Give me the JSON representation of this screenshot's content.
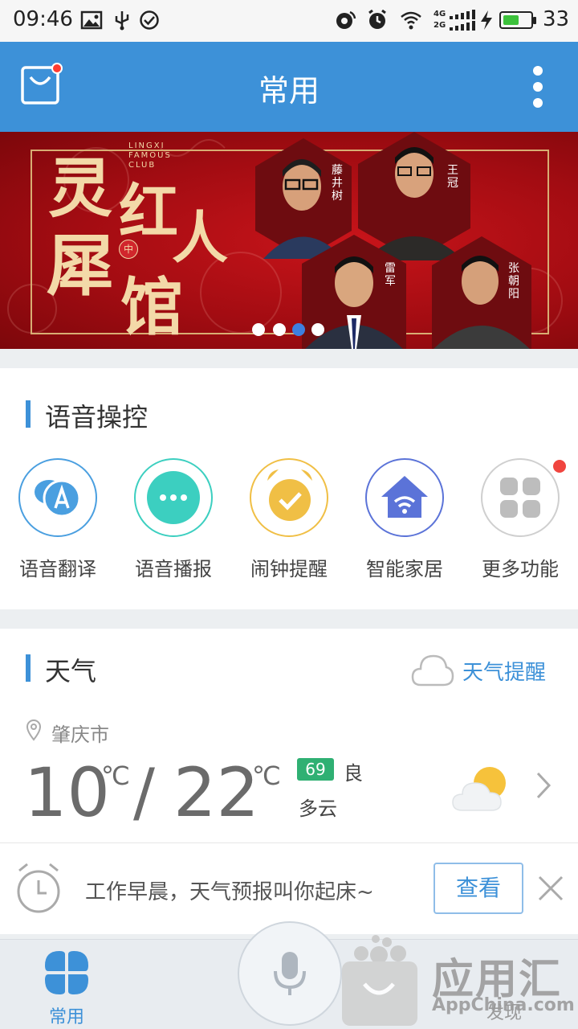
{
  "status_bar": {
    "time": "09:46",
    "battery": "33",
    "battery_level": 0.55,
    "network_labels": [
      "4G",
      "2G"
    ]
  },
  "header": {
    "title": "常用"
  },
  "banner": {
    "title_chars": [
      "灵",
      "犀",
      "红",
      "人",
      "馆"
    ],
    "badge": "中",
    "english": [
      "LINGXI",
      "FAMOUS",
      "CLUB"
    ],
    "people": [
      "藤井树",
      "王冠",
      "雷军",
      "张朝阳"
    ],
    "slide_count": 4,
    "active_slide": 3
  },
  "voice": {
    "title": "语音操控",
    "items": [
      {
        "label": "语音翻译",
        "icon": "translate-icon",
        "color": "#4a9fe0"
      },
      {
        "label": "语音播报",
        "icon": "chat-bubble-icon",
        "color": "#3ccfc0"
      },
      {
        "label": "闹钟提醒",
        "icon": "alarm-clock-icon",
        "color": "#f0bf45"
      },
      {
        "label": "智能家居",
        "icon": "smart-home-icon",
        "color": "#5b73d8"
      },
      {
        "label": "更多功能",
        "icon": "grid-icon",
        "color": "#bdbdbd"
      }
    ]
  },
  "weather": {
    "title": "天气",
    "reminder_link": "天气提醒",
    "city": "肇庆市",
    "low": "10",
    "high": "22",
    "unit": "℃",
    "separator": "/",
    "aqi": "69",
    "aqi_level": "良",
    "condition": "多云"
  },
  "tip": {
    "text": "工作早晨，天气预报叫你起床~",
    "button": "查看"
  },
  "bottom_nav": {
    "home_label": "常用",
    "discover_label": "发现"
  },
  "watermark": {
    "big": "应用汇",
    "small": "AppChina.com"
  },
  "colors": {
    "primary": "#3d91d8",
    "alert": "#f0453f",
    "aqi_good": "#2fb073"
  }
}
